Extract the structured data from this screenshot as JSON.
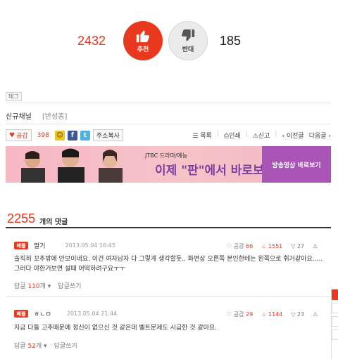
{
  "vote": {
    "up_count": "2432",
    "up_label": "추천",
    "down_label": "반대",
    "down_count": "185"
  },
  "tag_label": "태그",
  "channel": {
    "name": "신규채널",
    "item": "[반성종]"
  },
  "share": {
    "like_label": "공감",
    "like_count": "398",
    "addr_label": "주소복사"
  },
  "tools": {
    "list": "목록",
    "print": "인쇄",
    "report": "신고",
    "prev": "이전글",
    "next": "다음글"
  },
  "banner": {
    "jtbc": "JTBC 드라마/예능",
    "headline": "이제 \"판\"에서 바로보자!",
    "cta": "방송영상 바로보기"
  },
  "comments": {
    "count": "2255",
    "suffix": "개의 댓글",
    "items": [
      {
        "badge": "베플",
        "author": "딸기",
        "date": "2013.05.04 16:45",
        "empathy_label": "공감",
        "empathy": "66",
        "hot": "1551",
        "down": "27",
        "text": "솔직히 꼬추밖에 안보이네요. 이건 여자남자 다 그렇게 생각할듯.. 화면상 오른쪽 본인한테는 왼쪽으로 휘거같아요.....그러다 야한거보면 설때 어떡하려구요ㅜㅜ",
        "reply_label": "답글",
        "reply_count": "110",
        "reply_unit": "개",
        "write": "답글쓰기"
      },
      {
        "badge": "베플",
        "author": "ㅎㄴㅁ",
        "date": "2013.05.04 21:44",
        "empathy_label": "공감",
        "empathy": "29",
        "hot": "1144",
        "down": "23",
        "text": "지금 다들 고추때문에 정신이 없으신 것 같은데 벨트문제도 시급한 것 같아요.",
        "reply_label": "답글",
        "reply_count": "52",
        "reply_unit": "개",
        "write": "답글쓰기"
      }
    ]
  },
  "colors": {
    "accent": "#e8391f",
    "banner": "#a855b6"
  }
}
